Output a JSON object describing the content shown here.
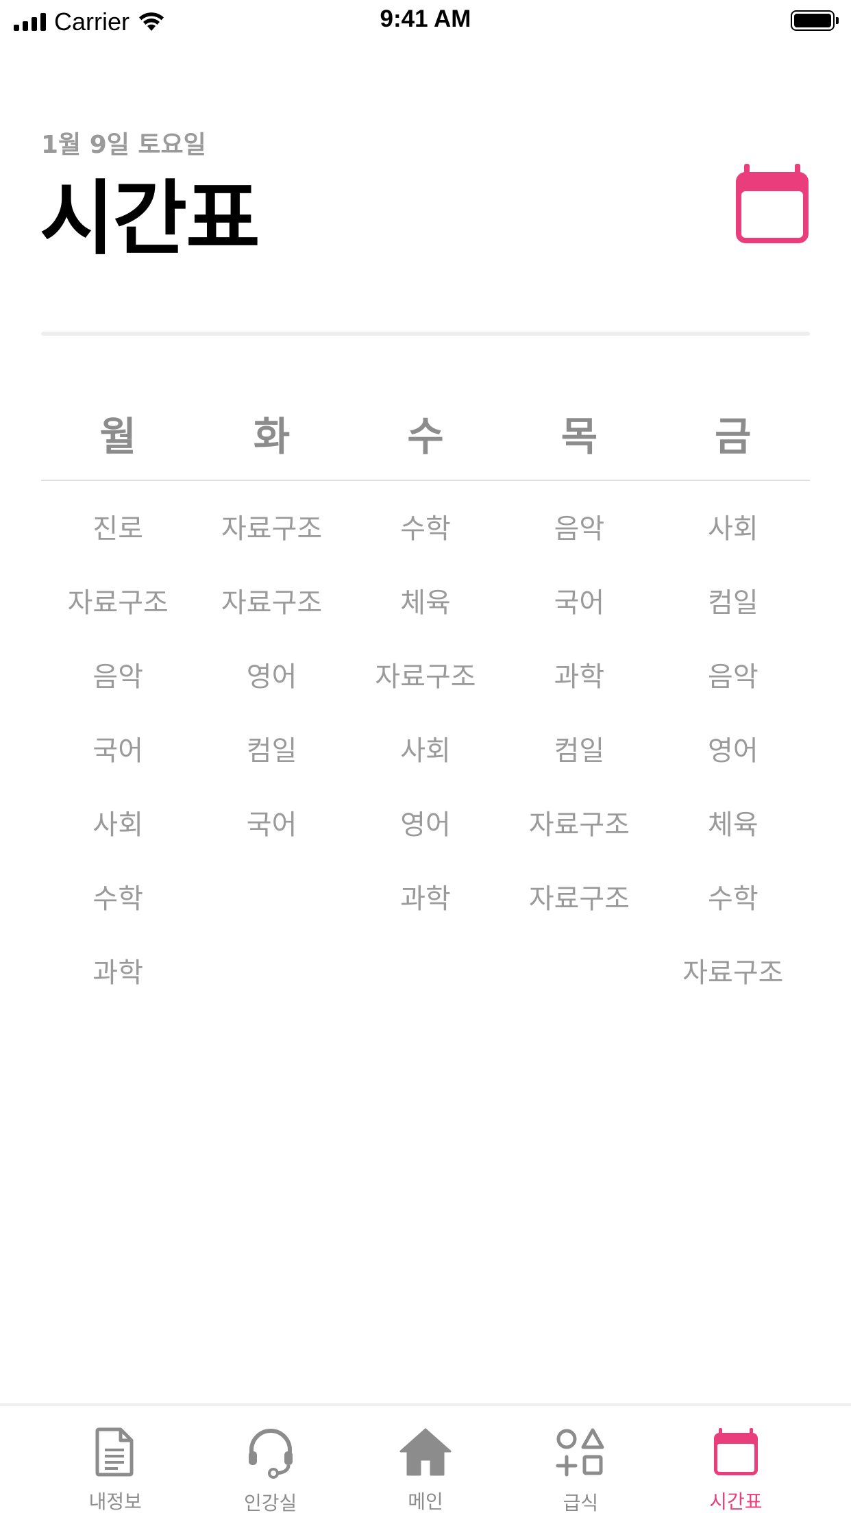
{
  "status_bar": {
    "carrier": "Carrier",
    "time": "9:41 AM"
  },
  "header": {
    "date": "1월 9일 토요일",
    "title": "시간표",
    "calendar_icon": "calendar-icon"
  },
  "accent_color": "#ea3d7b",
  "timetable": {
    "days": [
      "월",
      "화",
      "수",
      "목",
      "금"
    ],
    "columns": [
      [
        "진로",
        "자료구조",
        "음악",
        "국어",
        "사회",
        "수학",
        "과학"
      ],
      [
        "자료구조",
        "자료구조",
        "영어",
        "컴일",
        "국어"
      ],
      [
        "수학",
        "체육",
        "자료구조",
        "사회",
        "영어",
        "과학"
      ],
      [
        "음악",
        "국어",
        "과학",
        "컴일",
        "자료구조",
        "자료구조"
      ],
      [
        "사회",
        "컴일",
        "음악",
        "영어",
        "체육",
        "수학",
        "자료구조"
      ]
    ]
  },
  "tab_bar": {
    "tabs": [
      {
        "label": "내정보",
        "icon": "document-icon"
      },
      {
        "label": "인강실",
        "icon": "headset-icon"
      },
      {
        "label": "메인",
        "icon": "home-icon"
      },
      {
        "label": "급식",
        "icon": "shapes-icon"
      },
      {
        "label": "시간표",
        "icon": "calendar-icon",
        "active": true
      }
    ]
  }
}
